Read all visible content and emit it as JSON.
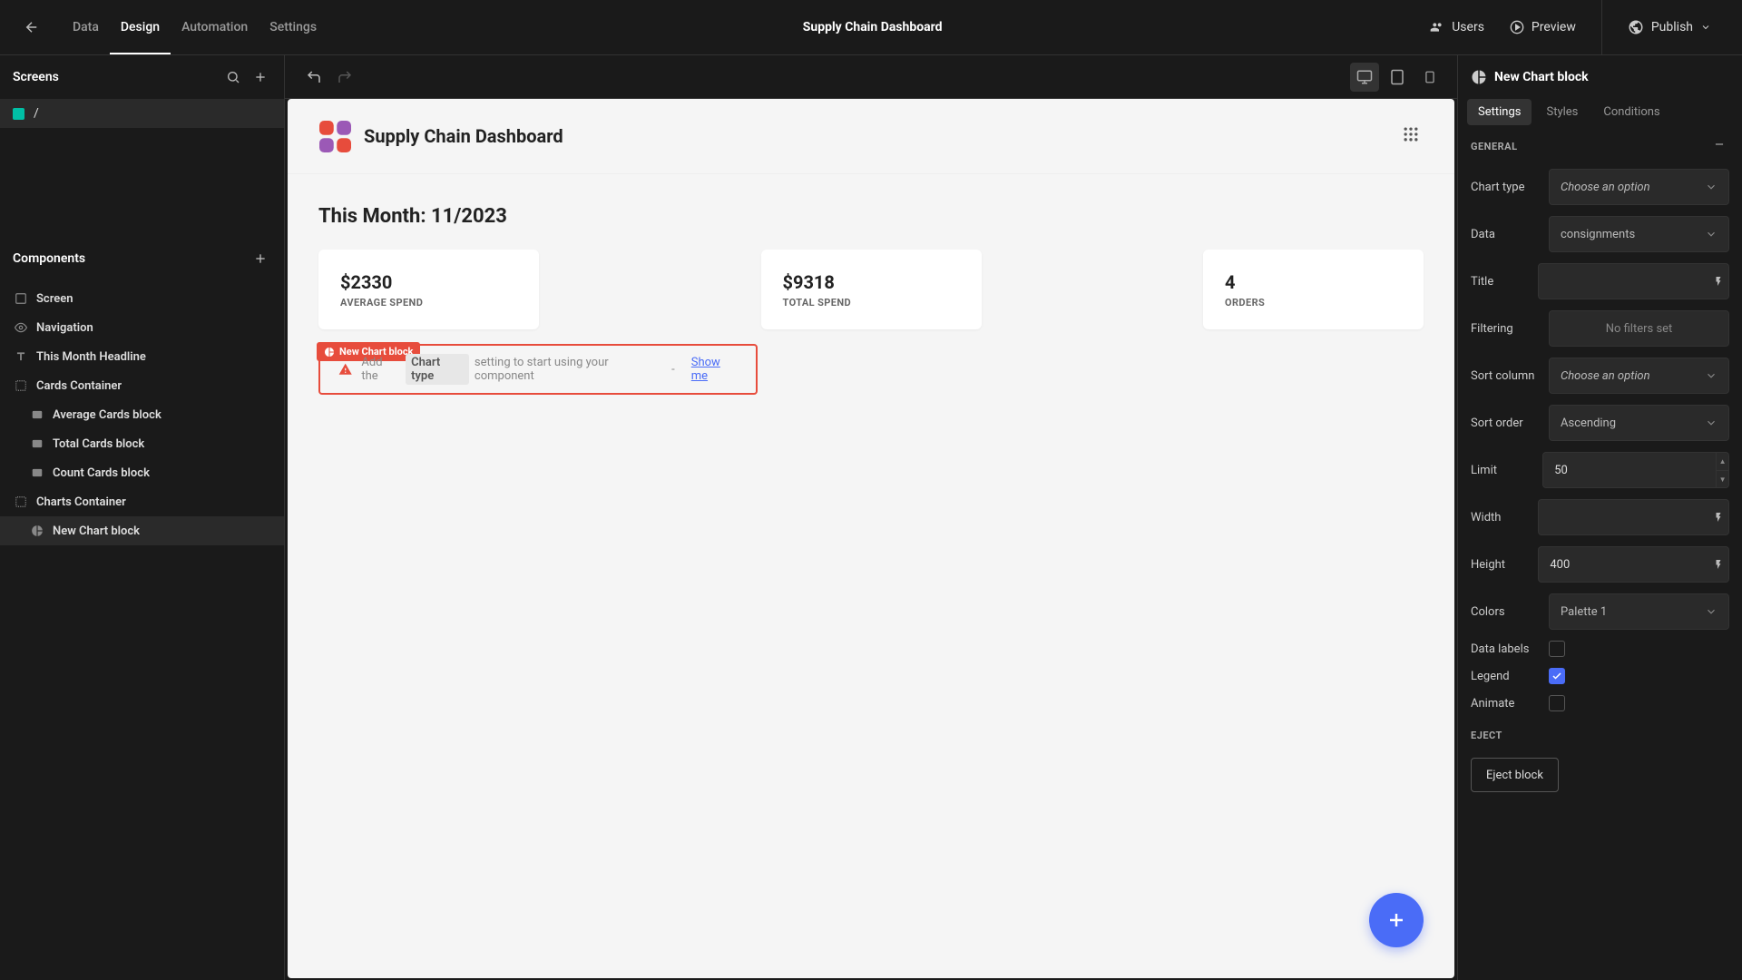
{
  "topbar": {
    "tabs": [
      "Data",
      "Design",
      "Automation",
      "Settings"
    ],
    "active_tab": "Design",
    "title": "Supply Chain Dashboard",
    "users": "Users",
    "preview": "Preview",
    "publish": "Publish"
  },
  "left": {
    "screens_label": "Screens",
    "screen_name": "/",
    "components_label": "Components",
    "tree": [
      {
        "label": "Screen",
        "indent": 0,
        "icon": "square"
      },
      {
        "label": "Navigation",
        "indent": 0,
        "icon": "eye"
      },
      {
        "label": "This Month Headline",
        "indent": 0,
        "icon": "text"
      },
      {
        "label": "Cards Container",
        "indent": 0,
        "icon": "container"
      },
      {
        "label": "Average Cards block",
        "indent": 1,
        "icon": "card"
      },
      {
        "label": "Total Cards block",
        "indent": 1,
        "icon": "card"
      },
      {
        "label": "Count Cards block",
        "indent": 1,
        "icon": "card"
      },
      {
        "label": "Charts Container",
        "indent": 0,
        "icon": "container"
      },
      {
        "label": "New Chart block",
        "indent": 1,
        "icon": "chart",
        "selected": true
      }
    ]
  },
  "canvas": {
    "app_title": "Supply Chain Dashboard",
    "month_title": "This Month: 11/2023",
    "cards": [
      {
        "value": "$2330",
        "label": "AVERAGE SPEND"
      },
      {
        "value": "$9318",
        "label": "TOTAL SPEND"
      },
      {
        "value": "4",
        "label": "ORDERS"
      }
    ],
    "sel_tag": "New Chart block",
    "warn_prefix": "Add the",
    "warn_chip": "Chart type",
    "warn_suffix": "setting to start using your component",
    "warn_sep": "-",
    "warn_show": "Show me"
  },
  "right": {
    "selected": "New Chart block",
    "tabs": [
      "Settings",
      "Styles",
      "Conditions"
    ],
    "active_tab": "Settings",
    "section_general": "GENERAL",
    "section_eject": "EJECT",
    "eject_btn": "Eject block",
    "fields": {
      "chart_type": {
        "label": "Chart type",
        "value": "Choose an option"
      },
      "data": {
        "label": "Data",
        "value": "consignments"
      },
      "title": {
        "label": "Title",
        "value": ""
      },
      "filtering": {
        "label": "Filtering",
        "value": "No filters set"
      },
      "sort_column": {
        "label": "Sort column",
        "value": "Choose an option"
      },
      "sort_order": {
        "label": "Sort order",
        "value": "Ascending"
      },
      "limit": {
        "label": "Limit",
        "value": "50"
      },
      "width": {
        "label": "Width",
        "value": ""
      },
      "height": {
        "label": "Height",
        "value": "400"
      },
      "colors": {
        "label": "Colors",
        "value": "Palette 1"
      },
      "data_labels": {
        "label": "Data labels",
        "checked": false
      },
      "legend": {
        "label": "Legend",
        "checked": true
      },
      "animate": {
        "label": "Animate",
        "checked": false
      }
    }
  }
}
